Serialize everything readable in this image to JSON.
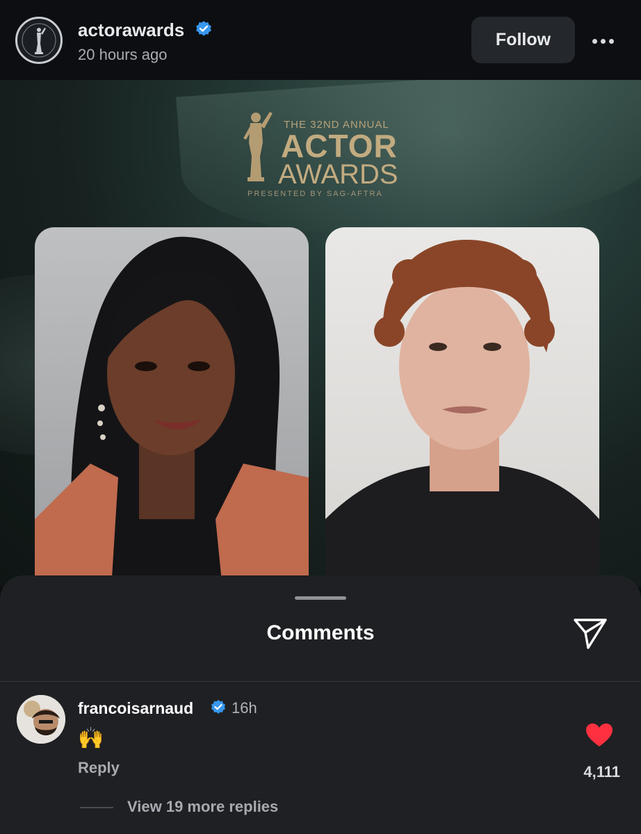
{
  "post": {
    "username": "actorawards",
    "time": "20 hours ago",
    "follow_label": "Follow",
    "more_icon": "more-horizontal-icon"
  },
  "image": {
    "logo_line1": "THE 32ND ANNUAL",
    "logo_line2": "ACTOR",
    "logo_line3": "AWARDS",
    "logo_line4": "PRESENTED BY SAG-AFTRA"
  },
  "comments": {
    "title": "Comments",
    "share_icon": "send-icon",
    "items": [
      {
        "username": "francoisarnaud",
        "time": "16h",
        "text": "🙌",
        "reply_label": "Reply",
        "likes": "4,111",
        "view_replies": "View 19 more replies"
      }
    ]
  },
  "colors": {
    "verified": "#3897f0",
    "heart": "#ff3040",
    "sheet": "#1f2023",
    "gold": "#c2ab80"
  }
}
